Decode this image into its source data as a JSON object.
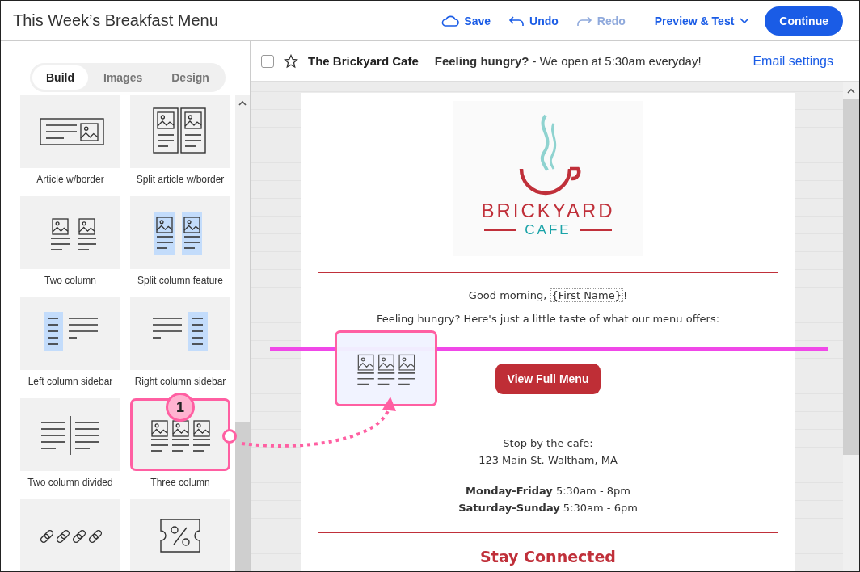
{
  "header": {
    "title": "This Week’s Breakfast Menu",
    "actions": [
      {
        "label": "Save",
        "kind": "save",
        "disabled": false
      },
      {
        "label": "Undo",
        "kind": "undo",
        "disabled": false
      },
      {
        "label": "Redo",
        "kind": "redo",
        "disabled": true
      }
    ],
    "preview": "Preview & Test",
    "continue": "Continue"
  },
  "sidebar": {
    "tabs": [
      {
        "label": "Build",
        "selected": true
      },
      {
        "label": "Images",
        "selected": false
      },
      {
        "label": "Design",
        "selected": false
      }
    ],
    "blocks": [
      {
        "label": "Article w/border",
        "kind": "article-border",
        "highlighted": false
      },
      {
        "label": "Split article w/border",
        "kind": "split-article-border",
        "highlighted": false
      },
      {
        "label": "Two column",
        "kind": "two-column",
        "highlighted": false
      },
      {
        "label": "Split column feature",
        "kind": "split-column-feature",
        "highlighted": false
      },
      {
        "label": "Left column sidebar",
        "kind": "left-column-sidebar",
        "highlighted": false
      },
      {
        "label": "Right column sidebar",
        "kind": "right-column-sidebar",
        "highlighted": false
      },
      {
        "label": "Two column divided",
        "kind": "two-column-divided",
        "highlighted": false
      },
      {
        "label": "Three column",
        "kind": "three-column",
        "highlighted": true
      },
      {
        "kind": "links",
        "highlighted": false
      },
      {
        "kind": "coupon",
        "highlighted": false
      }
    ]
  },
  "subject_bar": {
    "checked": false,
    "starred": false,
    "sender": "The Brickyard Cafe",
    "subject": "**Feeling hungry?** - We open at 5:30am everyday!",
    "settings": "Email settings"
  },
  "email": {
    "logo": {
      "name": "BRICKYARD",
      "tagline": "CAFE"
    },
    "greeting": "Good morning, ",
    "merge_field": "{First Name}",
    "greeting_end": "!",
    "intro": "Feeling hungry? Here's just a little taste of what our menu offers:",
    "button": "View Full Menu",
    "address": [
      "Stop by the cafe:",
      "123 Main St. Waltham, MA"
    ],
    "hours": [
      "**Monday-Friday** 5:30am - 8pm",
      "**Saturday-Sunday** 5:30am - 6pm"
    ],
    "social_heading": "Stay Connected"
  },
  "annotation": {
    "step": "1"
  }
}
